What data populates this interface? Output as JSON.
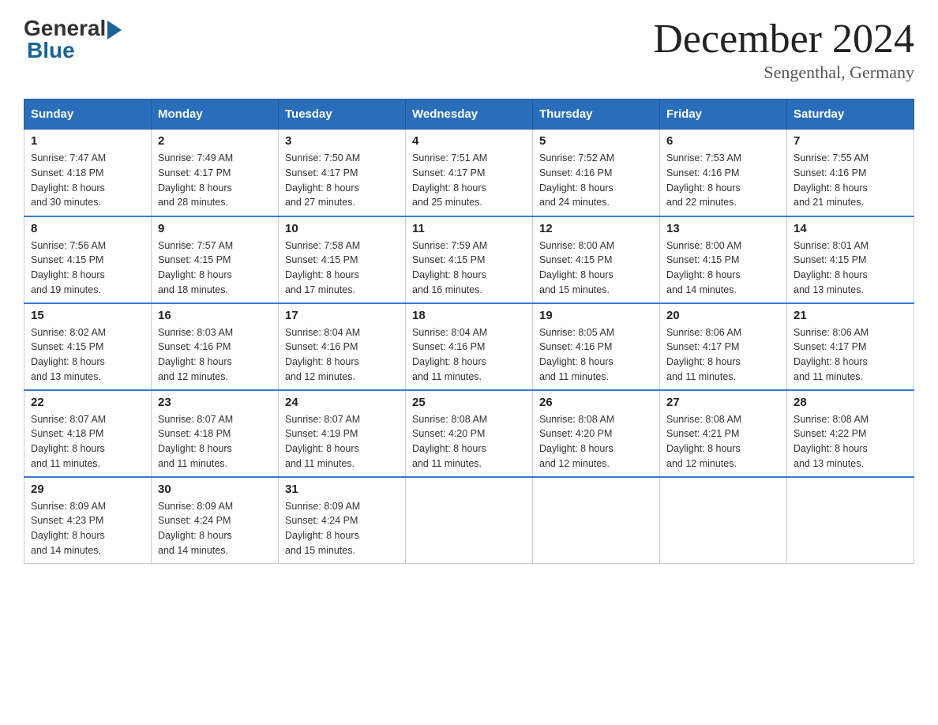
{
  "header": {
    "logo_general": "General",
    "logo_blue": "Blue",
    "month_year": "December 2024",
    "location": "Sengenthal, Germany"
  },
  "days_of_week": [
    "Sunday",
    "Monday",
    "Tuesday",
    "Wednesday",
    "Thursday",
    "Friday",
    "Saturday"
  ],
  "weeks": [
    [
      {
        "day": "1",
        "sunrise": "7:47 AM",
        "sunset": "4:18 PM",
        "daylight": "8 hours and 30 minutes."
      },
      {
        "day": "2",
        "sunrise": "7:49 AM",
        "sunset": "4:17 PM",
        "daylight": "8 hours and 28 minutes."
      },
      {
        "day": "3",
        "sunrise": "7:50 AM",
        "sunset": "4:17 PM",
        "daylight": "8 hours and 27 minutes."
      },
      {
        "day": "4",
        "sunrise": "7:51 AM",
        "sunset": "4:17 PM",
        "daylight": "8 hours and 25 minutes."
      },
      {
        "day": "5",
        "sunrise": "7:52 AM",
        "sunset": "4:16 PM",
        "daylight": "8 hours and 24 minutes."
      },
      {
        "day": "6",
        "sunrise": "7:53 AM",
        "sunset": "4:16 PM",
        "daylight": "8 hours and 22 minutes."
      },
      {
        "day": "7",
        "sunrise": "7:55 AM",
        "sunset": "4:16 PM",
        "daylight": "8 hours and 21 minutes."
      }
    ],
    [
      {
        "day": "8",
        "sunrise": "7:56 AM",
        "sunset": "4:15 PM",
        "daylight": "8 hours and 19 minutes."
      },
      {
        "day": "9",
        "sunrise": "7:57 AM",
        "sunset": "4:15 PM",
        "daylight": "8 hours and 18 minutes."
      },
      {
        "day": "10",
        "sunrise": "7:58 AM",
        "sunset": "4:15 PM",
        "daylight": "8 hours and 17 minutes."
      },
      {
        "day": "11",
        "sunrise": "7:59 AM",
        "sunset": "4:15 PM",
        "daylight": "8 hours and 16 minutes."
      },
      {
        "day": "12",
        "sunrise": "8:00 AM",
        "sunset": "4:15 PM",
        "daylight": "8 hours and 15 minutes."
      },
      {
        "day": "13",
        "sunrise": "8:00 AM",
        "sunset": "4:15 PM",
        "daylight": "8 hours and 14 minutes."
      },
      {
        "day": "14",
        "sunrise": "8:01 AM",
        "sunset": "4:15 PM",
        "daylight": "8 hours and 13 minutes."
      }
    ],
    [
      {
        "day": "15",
        "sunrise": "8:02 AM",
        "sunset": "4:15 PM",
        "daylight": "8 hours and 13 minutes."
      },
      {
        "day": "16",
        "sunrise": "8:03 AM",
        "sunset": "4:16 PM",
        "daylight": "8 hours and 12 minutes."
      },
      {
        "day": "17",
        "sunrise": "8:04 AM",
        "sunset": "4:16 PM",
        "daylight": "8 hours and 12 minutes."
      },
      {
        "day": "18",
        "sunrise": "8:04 AM",
        "sunset": "4:16 PM",
        "daylight": "8 hours and 11 minutes."
      },
      {
        "day": "19",
        "sunrise": "8:05 AM",
        "sunset": "4:16 PM",
        "daylight": "8 hours and 11 minutes."
      },
      {
        "day": "20",
        "sunrise": "8:06 AM",
        "sunset": "4:17 PM",
        "daylight": "8 hours and 11 minutes."
      },
      {
        "day": "21",
        "sunrise": "8:06 AM",
        "sunset": "4:17 PM",
        "daylight": "8 hours and 11 minutes."
      }
    ],
    [
      {
        "day": "22",
        "sunrise": "8:07 AM",
        "sunset": "4:18 PM",
        "daylight": "8 hours and 11 minutes."
      },
      {
        "day": "23",
        "sunrise": "8:07 AM",
        "sunset": "4:18 PM",
        "daylight": "8 hours and 11 minutes."
      },
      {
        "day": "24",
        "sunrise": "8:07 AM",
        "sunset": "4:19 PM",
        "daylight": "8 hours and 11 minutes."
      },
      {
        "day": "25",
        "sunrise": "8:08 AM",
        "sunset": "4:20 PM",
        "daylight": "8 hours and 11 minutes."
      },
      {
        "day": "26",
        "sunrise": "8:08 AM",
        "sunset": "4:20 PM",
        "daylight": "8 hours and 12 minutes."
      },
      {
        "day": "27",
        "sunrise": "8:08 AM",
        "sunset": "4:21 PM",
        "daylight": "8 hours and 12 minutes."
      },
      {
        "day": "28",
        "sunrise": "8:08 AM",
        "sunset": "4:22 PM",
        "daylight": "8 hours and 13 minutes."
      }
    ],
    [
      {
        "day": "29",
        "sunrise": "8:09 AM",
        "sunset": "4:23 PM",
        "daylight": "8 hours and 14 minutes."
      },
      {
        "day": "30",
        "sunrise": "8:09 AM",
        "sunset": "4:24 PM",
        "daylight": "8 hours and 14 minutes."
      },
      {
        "day": "31",
        "sunrise": "8:09 AM",
        "sunset": "4:24 PM",
        "daylight": "8 hours and 15 minutes."
      },
      null,
      null,
      null,
      null
    ]
  ],
  "labels": {
    "sunrise": "Sunrise:",
    "sunset": "Sunset:",
    "daylight": "Daylight:"
  }
}
